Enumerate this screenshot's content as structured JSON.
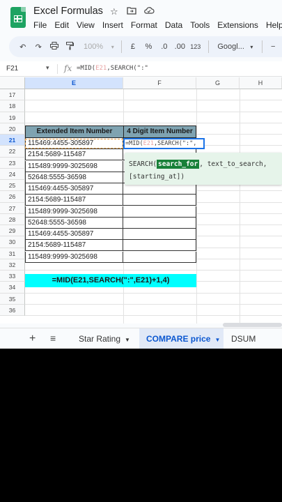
{
  "header": {
    "title": "Excel Formulas",
    "menu": [
      "File",
      "Edit",
      "View",
      "Insert",
      "Format",
      "Data",
      "Tools",
      "Extensions",
      "Help"
    ]
  },
  "toolbar": {
    "zoom": "100%",
    "currency": "£",
    "percent": "%",
    "decimal": ".0",
    "decimal_more": ".00",
    "number_format": "123",
    "font": "Googl..."
  },
  "formula_bar": {
    "cell_ref": "F21",
    "formula_prefix": "=MID(",
    "formula_ref": "E21",
    "formula_rest": ",SEARCH(\":\""
  },
  "grid": {
    "columns": [
      "E",
      "F",
      "G",
      "H"
    ],
    "rows": [
      "17",
      "18",
      "19",
      "20",
      "21",
      "22",
      "23",
      "24",
      "25",
      "26",
      "27",
      "28",
      "29",
      "30",
      "31",
      "32",
      "33",
      "34",
      "35",
      "36"
    ],
    "header_e": "Extended Item Number",
    "header_f": "4 Digit Item Number",
    "values": [
      "115469:4455-305897",
      "2154:5689-115487",
      "115489:9999-3025698",
      "52648:5555-36598",
      "115469:4455-305897",
      "2154:5689-115487",
      "115489:9999-3025698",
      "52648:5555-36598",
      "115469:4455-305897",
      "2154:5689-115487",
      "115489:9999-3025698"
    ],
    "active_prefix": "=MID(",
    "active_ref": "E21",
    "active_rest": ",SEARCH(\":\",",
    "formula_banner": "=MID(E21,SEARCH(\":\",E21)+1,4)"
  },
  "tooltip": {
    "fn": "SEARCH(",
    "arg1": "search_for",
    "arg2": ", text_to_search,",
    "arg3": "[starting_at])"
  },
  "sheets": {
    "star": "Star Rating",
    "compare": "COMPARE price",
    "dsum": "DSUM Functio"
  }
}
